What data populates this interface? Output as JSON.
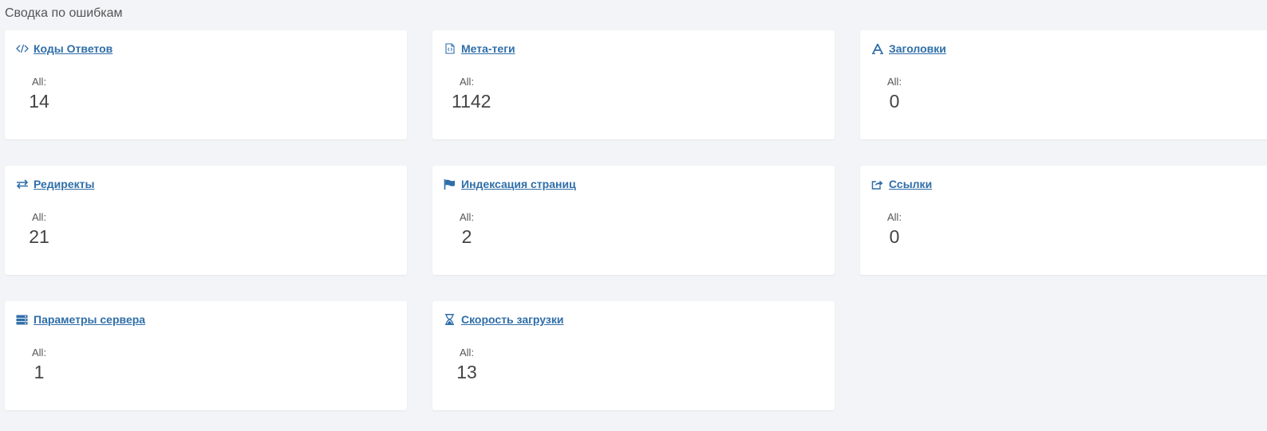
{
  "page": {
    "title": "Сводка по ошибкам"
  },
  "cards": [
    {
      "title": "Коды Ответов",
      "icon": "code-icon",
      "label": "All:",
      "value": "14"
    },
    {
      "title": "Мета-теги",
      "icon": "file-code-icon",
      "label": "All:",
      "value": "1142"
    },
    {
      "title": "Заголовки",
      "icon": "font-icon",
      "label": "All:",
      "value": "0"
    },
    {
      "title": "Редиректы",
      "icon": "exchange-icon",
      "label": "All:",
      "value": "21"
    },
    {
      "title": "Индексация страниц",
      "icon": "flag-icon",
      "label": "All:",
      "value": "2"
    },
    {
      "title": "Ссылки",
      "icon": "share-icon",
      "label": "All:",
      "value": "0"
    },
    {
      "title": "Параметры сервера",
      "icon": "server-icon",
      "label": "All:",
      "value": "1"
    },
    {
      "title": "Скорость загрузки",
      "icon": "hourglass-icon",
      "label": "All:",
      "value": "13"
    }
  ],
  "colors": {
    "background": "#f3f4f7",
    "card": "#ffffff",
    "link": "#2f6ea8",
    "text": "#444444"
  }
}
